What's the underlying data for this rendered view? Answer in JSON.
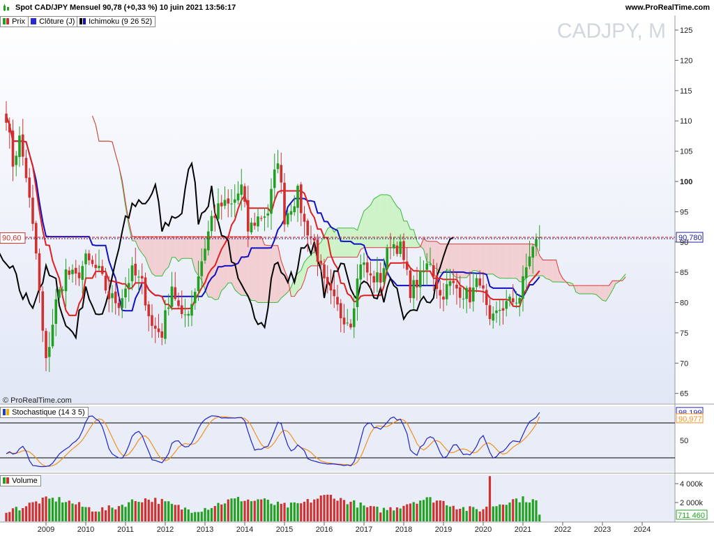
{
  "header": {
    "title": "Spot CAD/JPY Mensuel 90,78 (+0,33 %) 10 juin 2021 13:56:17",
    "site": "www.ProRealTime.com",
    "watermark": "CADJPY, M",
    "credit": "© ProRealTime.com"
  },
  "legend": {
    "prix": "Prix",
    "cloture": "Clôture (J)",
    "ichimoku": "Ichimoku (9 26 52)",
    "stochastic": "Stochastique (14 3 5)",
    "volume": "Volume"
  },
  "colors": {
    "bull": "#22a022",
    "bear": "#d03030",
    "tenkan": "#e02020",
    "kijun": "#1010c0",
    "chikou": "#000000",
    "cloud_green": "#cff3c9",
    "cloud_red": "#f2cfd3",
    "stoch_k": "#2222c8",
    "stoch_d": "#f09020",
    "price_label": "#2020a0"
  },
  "chart_data": [
    {
      "type": "candlestick",
      "panel": "price",
      "title": "CADJPY, M",
      "period": "monthly",
      "y_ticks": [
        65,
        70,
        75,
        80,
        85,
        90,
        95,
        100,
        105,
        110,
        115,
        120,
        125
      ],
      "ylim": [
        61.5,
        127.5
      ],
      "x_ticks": [
        "2009",
        "2010",
        "2011",
        "2012",
        "2013",
        "2014",
        "2015",
        "2016",
        "2017",
        "2018",
        "2019",
        "2020",
        "2021",
        "2022",
        "2023",
        "2024"
      ],
      "last_price": 90.78,
      "last_price_label": "90,780",
      "left_marker": 90.6,
      "left_marker_label": "90,60",
      "ichimoku": {
        "tenkan": 9,
        "kijun": 26,
        "senkou": 52,
        "lines": [
          "Tenkan",
          "Kijun",
          "Chikou",
          "Senkou A",
          "Senkou B"
        ]
      },
      "control_points": [
        {
          "date": "2008-01",
          "close": 111
        },
        {
          "date": "2008-03",
          "close": 103
        },
        {
          "date": "2008-05",
          "close": 107
        },
        {
          "date": "2008-07",
          "close": 101
        },
        {
          "date": "2008-10",
          "close": 88
        },
        {
          "date": "2008-12",
          "close": 75
        },
        {
          "date": "2009-01",
          "close": 70
        },
        {
          "date": "2009-04",
          "close": 80
        },
        {
          "date": "2009-07",
          "close": 85
        },
        {
          "date": "2009-10",
          "close": 84
        },
        {
          "date": "2010-01",
          "close": 87
        },
        {
          "date": "2010-05",
          "close": 85
        },
        {
          "date": "2010-08",
          "close": 81
        },
        {
          "date": "2010-11",
          "close": 80
        },
        {
          "date": "2011-03",
          "close": 85
        },
        {
          "date": "2011-06",
          "close": 83
        },
        {
          "date": "2011-09",
          "close": 76
        },
        {
          "date": "2011-12",
          "close": 75
        },
        {
          "date": "2012-03",
          "close": 83
        },
        {
          "date": "2012-06",
          "close": 77
        },
        {
          "date": "2012-09",
          "close": 80
        },
        {
          "date": "2012-12",
          "close": 87
        },
        {
          "date": "2013-03",
          "close": 94
        },
        {
          "date": "2013-06",
          "close": 96
        },
        {
          "date": "2013-09",
          "close": 96
        },
        {
          "date": "2013-12",
          "close": 99
        },
        {
          "date": "2014-02",
          "close": 92
        },
        {
          "date": "2014-05",
          "close": 94
        },
        {
          "date": "2014-08",
          "close": 95
        },
        {
          "date": "2014-11",
          "close": 104
        },
        {
          "date": "2015-01",
          "close": 94
        },
        {
          "date": "2015-05",
          "close": 98
        },
        {
          "date": "2015-07",
          "close": 93
        },
        {
          "date": "2015-10",
          "close": 90
        },
        {
          "date": "2016-01",
          "close": 83
        },
        {
          "date": "2016-06",
          "close": 78
        },
        {
          "date": "2016-09",
          "close": 77
        },
        {
          "date": "2016-12",
          "close": 87
        },
        {
          "date": "2017-03",
          "close": 84
        },
        {
          "date": "2017-06",
          "close": 84
        },
        {
          "date": "2017-09",
          "close": 90
        },
        {
          "date": "2017-12",
          "close": 89
        },
        {
          "date": "2018-03",
          "close": 82
        },
        {
          "date": "2018-06",
          "close": 84
        },
        {
          "date": "2018-09",
          "close": 87
        },
        {
          "date": "2018-12",
          "close": 81
        },
        {
          "date": "2019-03",
          "close": 83
        },
        {
          "date": "2019-06",
          "close": 82
        },
        {
          "date": "2019-09",
          "close": 81
        },
        {
          "date": "2019-12",
          "close": 84
        },
        {
          "date": "2020-03",
          "close": 76
        },
        {
          "date": "2020-06",
          "close": 79
        },
        {
          "date": "2020-09",
          "close": 80
        },
        {
          "date": "2020-12",
          "close": 81
        },
        {
          "date": "2021-03",
          "close": 88
        },
        {
          "date": "2021-06",
          "close": 90.78
        }
      ]
    },
    {
      "type": "line",
      "panel": "stochastic",
      "title": "Stochastique (14 3 5)",
      "y_ticks": [
        50
      ],
      "levels": [
        80,
        20
      ],
      "ylim": [
        0,
        100
      ],
      "last_k": 98.199,
      "last_k_label": "98,199",
      "last_d": 90.977,
      "last_d_label": "90,977"
    },
    {
      "type": "bar",
      "panel": "volume",
      "title": "Volume",
      "y_ticks": [
        2000,
        4000
      ],
      "y_tick_labels": [
        "2 000k",
        "4 000k"
      ],
      "ylim": [
        0,
        5000
      ],
      "last_value": 711460,
      "last_value_label": "711 460",
      "spike_date": "2020-03",
      "spike_value": 4800
    }
  ]
}
